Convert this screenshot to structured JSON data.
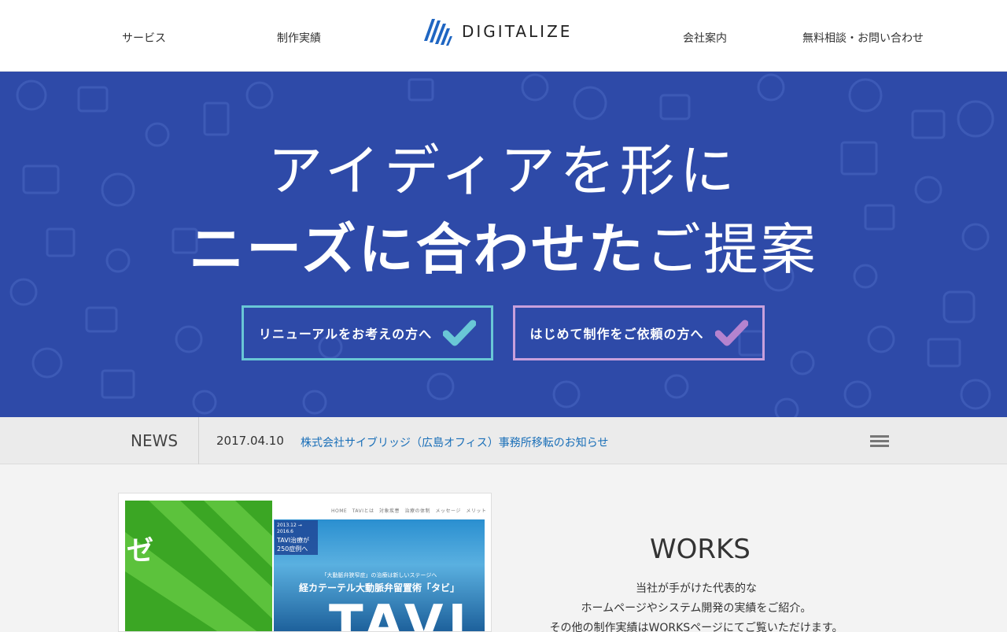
{
  "header": {
    "nav_services": "サービス",
    "nav_works": "制作実績",
    "logo_text": "DIGITALIZE",
    "nav_company": "会社案内",
    "nav_contact": "無料相談・お問い合わせ"
  },
  "hero": {
    "line1": "アイディアを形に",
    "line2_bold": "ニーズに合わせた",
    "line2_light": "ご提案",
    "cta_renewal": "リニューアルをお考えの方へ",
    "cta_first": "はじめて制作をご依頼の方へ",
    "background_color": "#2e4aa8",
    "cta_renewal_color": "#69c7d6",
    "cta_first_color": "#c8a0dc"
  },
  "news": {
    "label": "NEWS",
    "date": "2017.04.10",
    "headline": "株式会社サイブリッジ（広島オフィス）事務所移転のお知らせ"
  },
  "works": {
    "title": "WORKS",
    "desc_line1": "当社が手がけた代表的な",
    "desc_line2": "ホームページやシステム開発の実績をご紹介。",
    "desc_line3": "その他の制作実績はWORKSページにてご覧いただけます。",
    "thumb": {
      "nav": "HOME　TAVIとは　対象疾患　治療の体制　メッセージ　メリット　Q&A　お問",
      "badge_line1": "2013.12 → 2016.6",
      "badge_line2": "TAVI治療が",
      "badge_line3": "250症例へ",
      "caption_small": "「大動脈弁狭窄症」の治療は新しいステージへ",
      "caption_main": "経カテーテル大動脈弁留置術「タビ」",
      "big_text": "TAVI"
    }
  }
}
